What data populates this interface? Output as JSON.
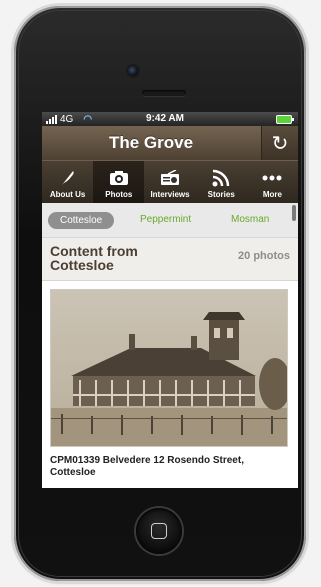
{
  "status": {
    "network": "4G",
    "time": "9:42 AM"
  },
  "app": {
    "title": "The Grove"
  },
  "tabs": [
    {
      "label": "About Us",
      "icon": "quill-icon"
    },
    {
      "label": "Photos",
      "icon": "camera-icon",
      "active": true
    },
    {
      "label": "Interviews",
      "icon": "radio-icon"
    },
    {
      "label": "Stories",
      "icon": "rss-icon"
    },
    {
      "label": "More",
      "icon": "more-dots-icon"
    }
  ],
  "filters": [
    {
      "label": "Cottesloe",
      "selected": true
    },
    {
      "label": "Peppermint",
      "selected": false
    },
    {
      "label": "Mosman",
      "selected": false
    }
  ],
  "content": {
    "title": "Content from Cottesloe",
    "count": "20 photos"
  },
  "item": {
    "caption": "CPM01339 Belvedere 12 Rosendo Street, Cottesloe"
  },
  "colors": {
    "header_brown": "#6b5b49",
    "filter_link": "#6aa82a"
  }
}
